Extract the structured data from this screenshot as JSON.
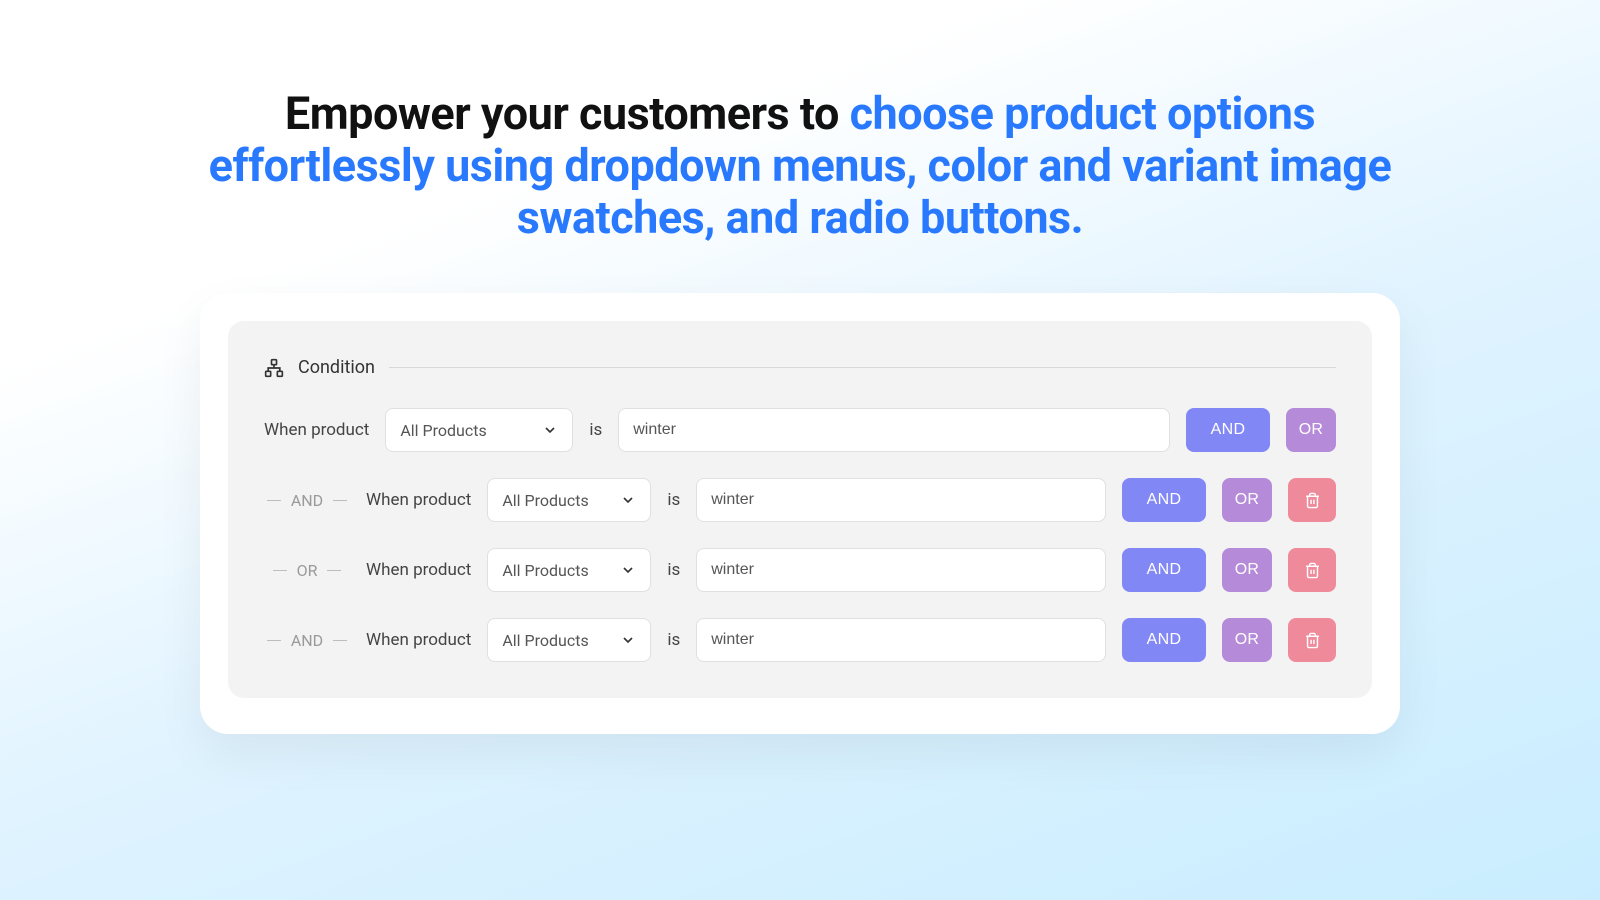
{
  "headline": {
    "plain": "Empower your customers to ",
    "accent": "choose product options effortlessly using dropdown menus, color and variant image swatches, and radio buttons."
  },
  "section_title": "Condition",
  "labels": {
    "when_product": "When product",
    "is": "is"
  },
  "connectors": {
    "and": "AND",
    "or": "OR"
  },
  "buttons": {
    "and": "AND",
    "or": "OR"
  },
  "rows": [
    {
      "connector": null,
      "select": "All Products",
      "value": "winter",
      "has_delete": false
    },
    {
      "connector": "AND",
      "select": "All Products",
      "value": "winter",
      "has_delete": true
    },
    {
      "connector": "OR",
      "select": "All Products",
      "value": "winter",
      "has_delete": true
    },
    {
      "connector": "AND",
      "select": "All Products",
      "value": "winter",
      "has_delete": true
    }
  ]
}
